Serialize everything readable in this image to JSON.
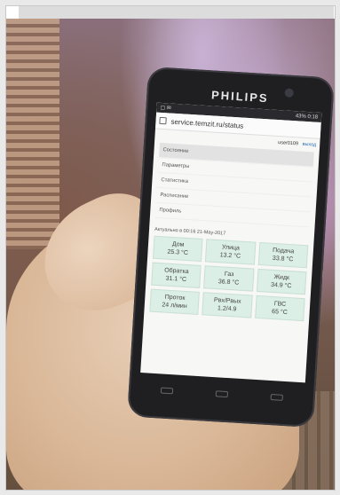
{
  "phone": {
    "brand": "PHILIPS"
  },
  "status_bar": {
    "right": "43% 0:18"
  },
  "browser": {
    "url": "service.temzit.ru/status"
  },
  "user": {
    "name": "user0109",
    "logout": "выход"
  },
  "menu": {
    "items": [
      {
        "label": "Состояние"
      },
      {
        "label": "Параметры"
      },
      {
        "label": "Статистика"
      },
      {
        "label": "Расписание"
      },
      {
        "label": "Профиль"
      }
    ]
  },
  "updated_text": "Актуально в 00:16 21-May-2017",
  "tiles": [
    {
      "label": "Дом",
      "value": "25.3 °C"
    },
    {
      "label": "Улица",
      "value": "13.2 °C"
    },
    {
      "label": "Подача",
      "value": "33.8 °C"
    },
    {
      "label": "Обратка",
      "value": "31.1 °C"
    },
    {
      "label": "Газ",
      "value": "36.8 °C"
    },
    {
      "label": "Жидк",
      "value": "34.9 °C"
    },
    {
      "label": "Проток",
      "value": "24 л/мин"
    },
    {
      "label": "Рвх/Рвых",
      "value": "1.2/4.9"
    },
    {
      "label": "ГВС",
      "value": "65 °C"
    }
  ]
}
